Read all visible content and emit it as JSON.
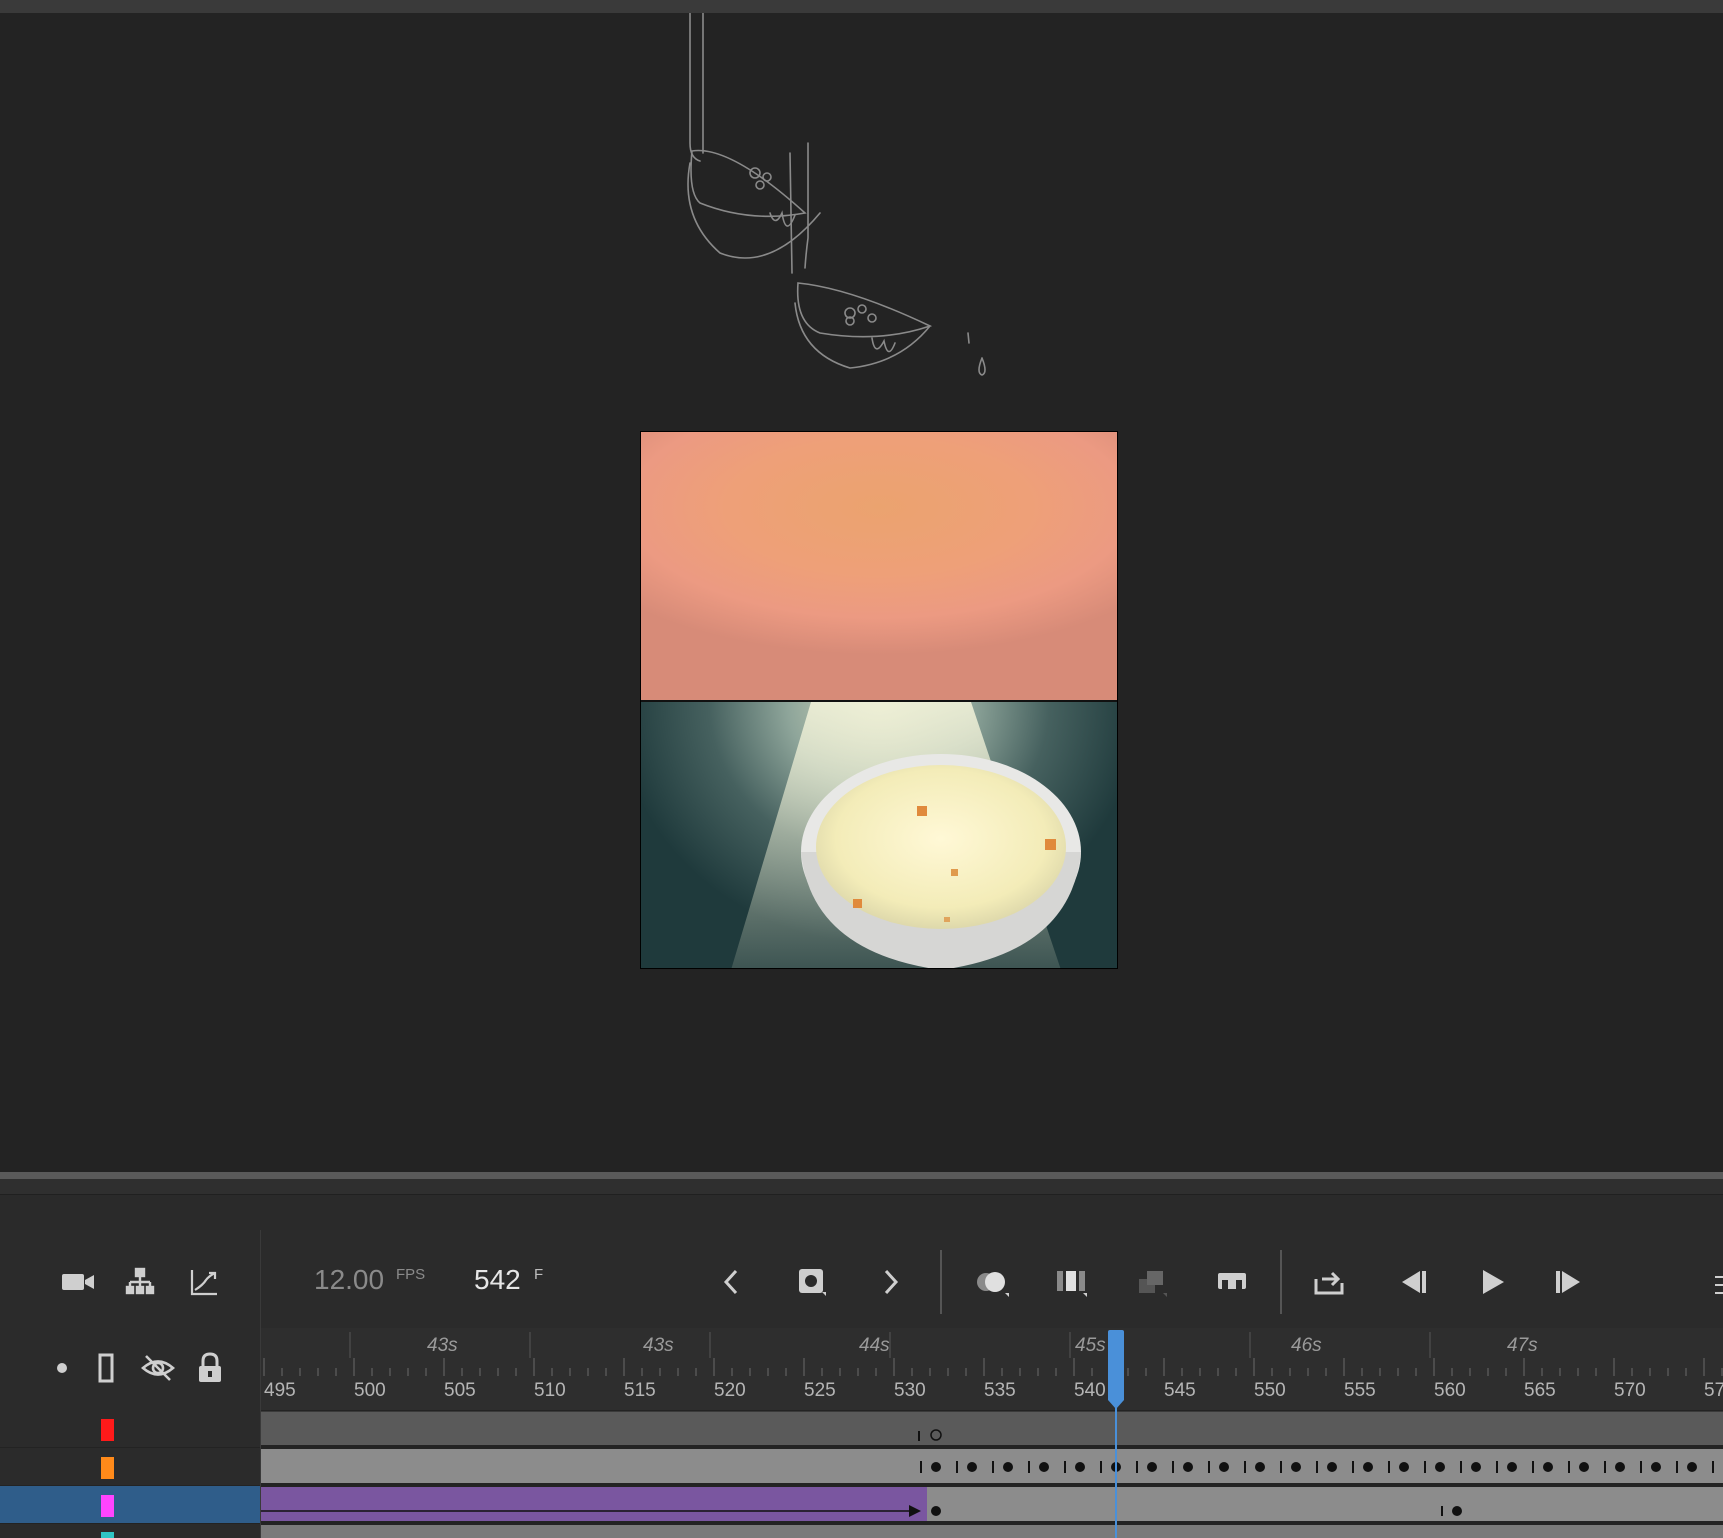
{
  "timeline": {
    "fps_value": "12.00",
    "fps_unit": "FPS",
    "current_frame": "542",
    "frame_unit": "F",
    "seconds_labels": [
      "43s",
      "43s",
      "44s",
      "45s",
      "46s",
      "47s"
    ],
    "frame_labels": [
      "495",
      "500",
      "505",
      "510",
      "515",
      "520",
      "525",
      "530",
      "535",
      "540",
      "545",
      "550",
      "555",
      "560",
      "565",
      "570",
      "57"
    ]
  },
  "layers": [
    {
      "color": "#ff1a1a"
    },
    {
      "color": "#ff8a1a"
    },
    {
      "color": "#ff44ff"
    },
    {
      "color": "#2ec4c4"
    }
  ],
  "colors": {
    "accent": "#4a90d9",
    "tween": "#7a56a0",
    "selected_layer": "#2f5d8a"
  },
  "icons": {
    "camera": "camera-icon",
    "hierarchy": "layer-hierarchy-icon",
    "graph": "easing-graph-icon",
    "prev": "chevron-left-icon",
    "insert_keyframe": "insert-keyframe-icon",
    "next": "chevron-right-icon",
    "onion": "onion-skin-icon",
    "edit_multiple": "edit-multiple-frames-icon",
    "paste": "paste-frames-icon",
    "clip": "clip-frames-icon",
    "loop": "loop-icon",
    "step_back": "step-back-icon",
    "play": "play-icon",
    "step_forward": "step-forward-icon",
    "show_dot": "layer-dot-icon",
    "outline": "outline-icon",
    "hide": "visibility-off-icon",
    "lock": "lock-icon"
  }
}
